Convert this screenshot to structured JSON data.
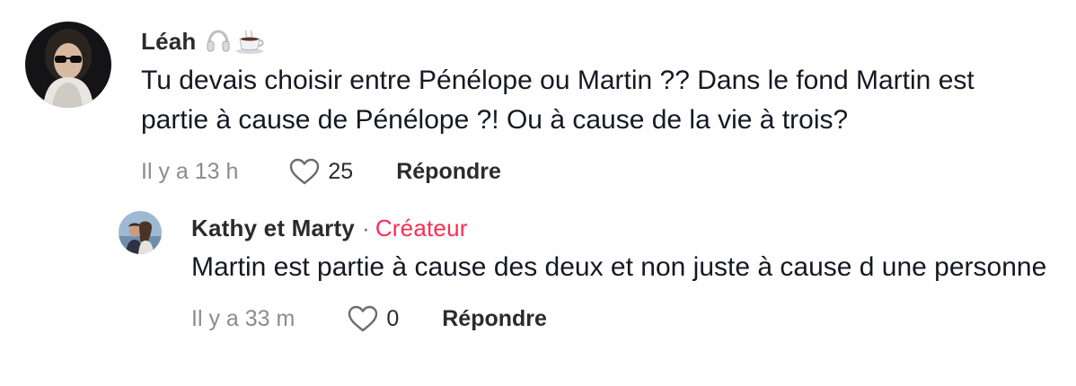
{
  "comments": [
    {
      "username": "Léah",
      "emojis": [
        "headphones-emoji",
        "coffee-emoji"
      ],
      "text": "Tu devais choisir entre Pénélope ou Martin ?? Dans le fond Martin est partie à cause de Pénélope ?! Ou à cause de la vie à trois?",
      "timestamp": "Il y a 13 h",
      "likes": "25",
      "reply_label": "Répondre"
    },
    {
      "username": "Kathy et Marty",
      "separator": "·",
      "badge": "Créateur",
      "text": "Martin est partie à cause des deux et non juste à cause d une personne",
      "timestamp": "Il y a 33 m",
      "likes": "0",
      "reply_label": "Répondre"
    }
  ],
  "colors": {
    "creator_badge": "#fe2c55",
    "timestamp": "#8a8b91",
    "text": "#161823"
  }
}
